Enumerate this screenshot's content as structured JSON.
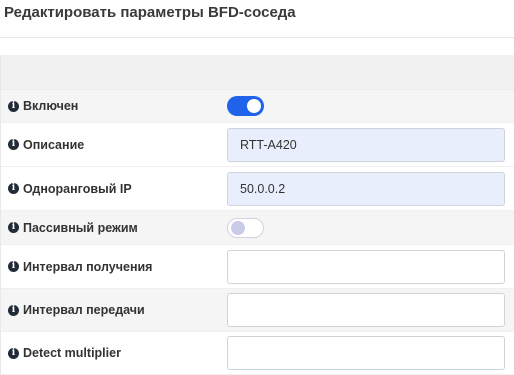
{
  "header": {
    "title": "Редактировать параметры BFD-соседа"
  },
  "colors": {
    "accent": "#1f63ea",
    "filled_input_bg": "#e8eefb",
    "row_alt_bg": "#f5f5f5"
  },
  "form": {
    "rows": [
      {
        "label": "Включен",
        "icon": "info-icon",
        "type": "toggle",
        "state": "on"
      },
      {
        "label": "Описание",
        "icon": "info-icon",
        "type": "input",
        "value": "RTT-A420"
      },
      {
        "label": "Одноранговый IP",
        "icon": "info-icon",
        "type": "input",
        "value": "50.0.0.2"
      },
      {
        "label": "Пассивный режим",
        "icon": "info-icon",
        "type": "toggle",
        "state": "off"
      },
      {
        "label": "Интервал получения",
        "icon": "info-icon",
        "type": "input",
        "value": ""
      },
      {
        "label": "Интервал передачи",
        "icon": "info-icon",
        "type": "input",
        "value": ""
      },
      {
        "label": "Detect multiplier",
        "icon": "info-icon",
        "type": "input",
        "value": ""
      }
    ]
  }
}
